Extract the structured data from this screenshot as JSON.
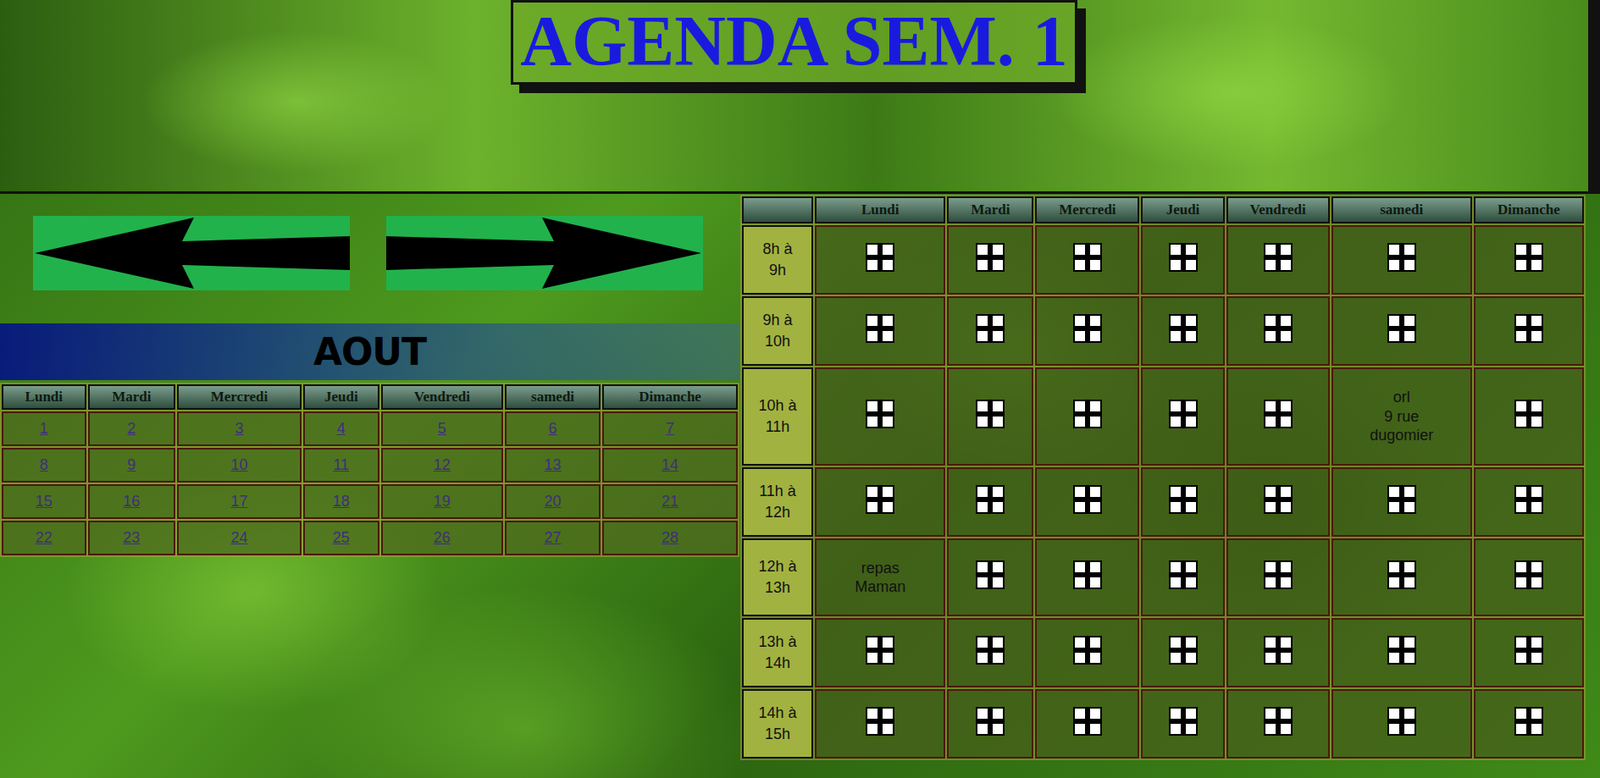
{
  "title": "AGENDA SEM. 1",
  "month": {
    "name": "AOUT",
    "weekdays": [
      "Lundi",
      "Mardi",
      "Mercredi",
      "Jeudi",
      "Vendredi",
      "samedi",
      "Dimanche"
    ],
    "weeks": [
      [
        "1",
        "2",
        "3",
        "4",
        "5",
        "6",
        "7"
      ],
      [
        "8",
        "9",
        "10",
        "11",
        "12",
        "13",
        "14"
      ],
      [
        "15",
        "16",
        "17",
        "18",
        "19",
        "20",
        "21"
      ],
      [
        "22",
        "23",
        "24",
        "25",
        "26",
        "27",
        "28"
      ]
    ]
  },
  "agenda": {
    "days": [
      "Lundi",
      "Mardi",
      "Mercredi",
      "Jeudi",
      "Vendredi",
      "samedi",
      "Dimanche"
    ],
    "slots": [
      {
        "time": "8h à 9h",
        "cells": [
          {
            "kind": "add"
          },
          {
            "kind": "add"
          },
          {
            "kind": "add"
          },
          {
            "kind": "add"
          },
          {
            "kind": "add"
          },
          {
            "kind": "add"
          },
          {
            "kind": "add"
          }
        ]
      },
      {
        "time": "9h à 10h",
        "cells": [
          {
            "kind": "add"
          },
          {
            "kind": "add"
          },
          {
            "kind": "add"
          },
          {
            "kind": "add"
          },
          {
            "kind": "add"
          },
          {
            "kind": "add"
          },
          {
            "kind": "add"
          }
        ]
      },
      {
        "time": "10h à 11h",
        "cells": [
          {
            "kind": "add"
          },
          {
            "kind": "add"
          },
          {
            "kind": "add"
          },
          {
            "kind": "add"
          },
          {
            "kind": "add"
          },
          {
            "kind": "note",
            "lines": [
              "orl",
              "9 rue",
              "dugomier"
            ]
          },
          {
            "kind": "add"
          }
        ]
      },
      {
        "time": "11h à 12h",
        "cells": [
          {
            "kind": "add"
          },
          {
            "kind": "add"
          },
          {
            "kind": "add"
          },
          {
            "kind": "add"
          },
          {
            "kind": "add"
          },
          {
            "kind": "add"
          },
          {
            "kind": "add"
          }
        ]
      },
      {
        "time": "12h à 13h",
        "cells": [
          {
            "kind": "note",
            "lines": [
              "repas",
              "Maman"
            ]
          },
          {
            "kind": "add"
          },
          {
            "kind": "add"
          },
          {
            "kind": "add"
          },
          {
            "kind": "add"
          },
          {
            "kind": "add"
          },
          {
            "kind": "add"
          }
        ]
      },
      {
        "time": "13h à 14h",
        "cells": [
          {
            "kind": "add"
          },
          {
            "kind": "add"
          },
          {
            "kind": "add"
          },
          {
            "kind": "add"
          },
          {
            "kind": "add"
          },
          {
            "kind": "add"
          },
          {
            "kind": "add"
          }
        ]
      },
      {
        "time": "14h à 15h",
        "cells": [
          {
            "kind": "add"
          },
          {
            "kind": "add"
          },
          {
            "kind": "add"
          },
          {
            "kind": "add"
          },
          {
            "kind": "add"
          },
          {
            "kind": "add"
          },
          {
            "kind": "add"
          }
        ]
      }
    ]
  }
}
